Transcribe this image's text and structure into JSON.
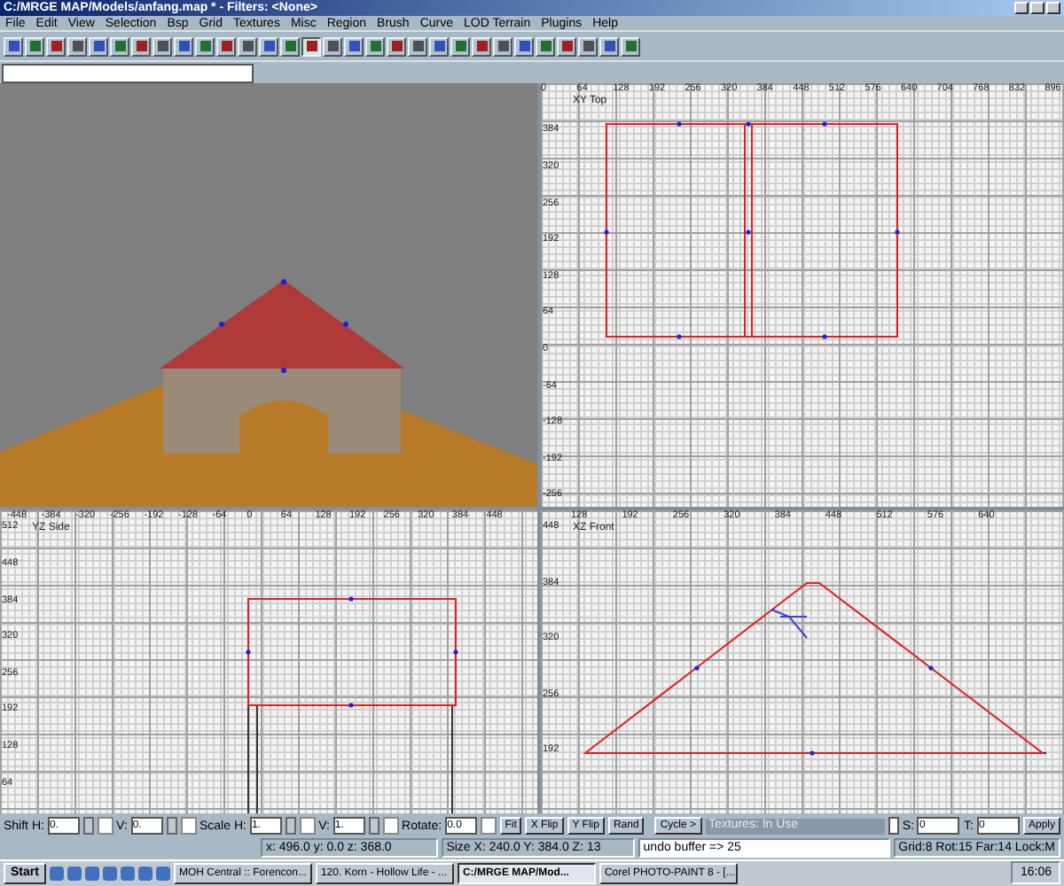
{
  "window": {
    "title": "C:/MRGE MAP/Models/anfang.map * - Filters: <None>"
  },
  "menu": [
    "File",
    "Edit",
    "View",
    "Selection",
    "Bsp",
    "Grid",
    "Textures",
    "Misc",
    "Region",
    "Brush",
    "Curve",
    "LOD Terrain",
    "Plugins",
    "Help"
  ],
  "toolbar": [
    {
      "pressed": false
    },
    {
      "pressed": false
    },
    {
      "pressed": false
    },
    {
      "pressed": false
    },
    {
      "pressed": false
    },
    {
      "pressed": false
    },
    {
      "pressed": false
    },
    {
      "pressed": false
    },
    {
      "pressed": false
    },
    {
      "pressed": false
    },
    {
      "pressed": false
    },
    {
      "pressed": false
    },
    {
      "pressed": false
    },
    {
      "pressed": false
    },
    {
      "pressed": true
    },
    {
      "pressed": false
    },
    {
      "pressed": false
    },
    {
      "pressed": false
    },
    {
      "pressed": false
    },
    {
      "pressed": false
    },
    {
      "pressed": false
    },
    {
      "pressed": false
    },
    {
      "pressed": false
    },
    {
      "pressed": false
    },
    {
      "pressed": false
    },
    {
      "pressed": false
    },
    {
      "pressed": false
    },
    {
      "pressed": false
    },
    {
      "pressed": false
    },
    {
      "pressed": false
    }
  ],
  "views": [
    {
      "kind": "camera"
    },
    {
      "kind": "top",
      "label": "XY Top",
      "x_ticks": [
        "0",
        "64",
        "128",
        "192",
        "256",
        "320",
        "384",
        "448",
        "512",
        "576",
        "640",
        "704",
        "768",
        "832",
        "896"
      ],
      "y_ticks": [
        "384",
        "320",
        "256",
        "192",
        "128",
        "64",
        "0",
        "-64",
        "-128",
        "-192",
        "-256"
      ]
    },
    {
      "kind": "side",
      "label": "YZ Side",
      "x_ticks": [
        "-448",
        "-384",
        "-320",
        "-256",
        "-192",
        "-128",
        "-64",
        "0",
        "64",
        "128",
        "192",
        "256",
        "320",
        "384",
        "448"
      ],
      "y_ticks": [
        "512",
        "448",
        "384",
        "320",
        "256",
        "192",
        "128",
        "64"
      ]
    },
    {
      "kind": "front",
      "label": "XZ Front",
      "x_ticks": [
        "128",
        "192",
        "256",
        "320",
        "384",
        "448",
        "512",
        "576",
        "640"
      ],
      "y_ticks": [
        "448",
        "384",
        "320",
        "256",
        "192"
      ]
    }
  ],
  "surface": {
    "shift_h": "0.",
    "shift_v": "0.",
    "scale_h": "1.",
    "scale_v": "1.",
    "rotate": "0.0",
    "labels": [
      "Shift H:",
      "V:",
      "Scale H:",
      "V:",
      "Rotate:"
    ],
    "buttons": [
      "Fit",
      "X Flip",
      "Y Flip",
      "Rand"
    ],
    "cycle": "Cycle >",
    "textures": "Textures: In Use",
    "s_label": "S:",
    "s": "0",
    "t_label": "T:",
    "t": "0",
    "apply": "Apply"
  },
  "status_bar": {
    "position": "x:  496.0   y:  0.0   z:  368.0",
    "size": "Size X:  240.0  Y:  384.0  Z:  13",
    "undo": "undo buffer => 25",
    "grid": "Grid:8 Rot:15 Far:14 Lock:M"
  },
  "taskbar": {
    "start": "Start",
    "tasks": [
      {
        "label": "MOH Central :: Forencon...",
        "selected": false
      },
      {
        "label": "120. Korn - Hollow Life - ...",
        "selected": false
      },
      {
        "label": "C:/MRGE MAP/Mod...",
        "selected": true
      },
      {
        "label": "Corel PHOTO-PAINT 8 - [...",
        "selected": false
      }
    ],
    "clock": "16:06"
  }
}
